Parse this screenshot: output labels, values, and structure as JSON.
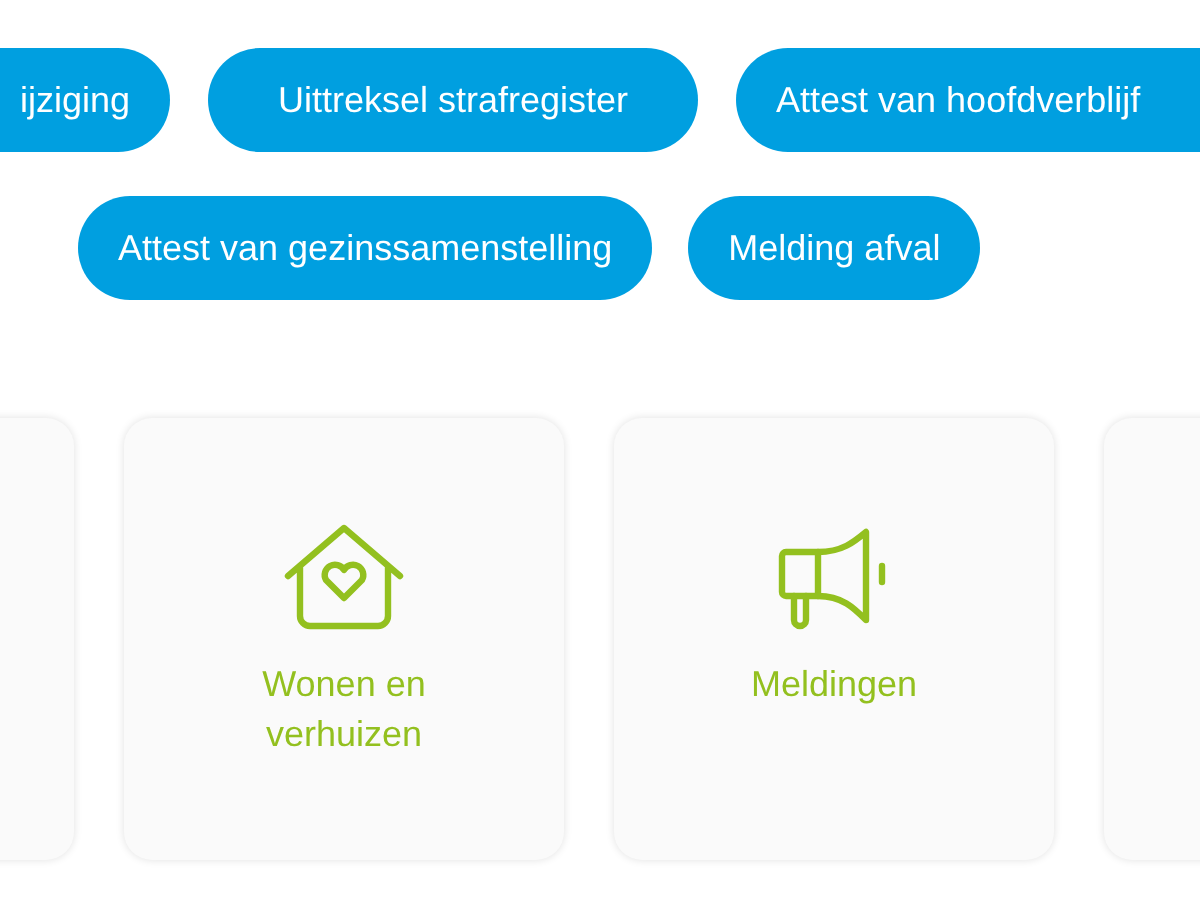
{
  "pill_rows": [
    {
      "pills": [
        "ijziging",
        "Uittreksel strafregister",
        "Attest van hoofdverblijf"
      ]
    },
    {
      "pills": [
        "Attest van gezinssamenstelling",
        "Melding afval"
      ]
    }
  ],
  "cards": [
    {
      "kind": "blank"
    },
    {
      "kind": "house",
      "title": "Wonen en verhuizen"
    },
    {
      "kind": "megaphone",
      "title": "Meldingen"
    },
    {
      "kind": "blank"
    }
  ]
}
